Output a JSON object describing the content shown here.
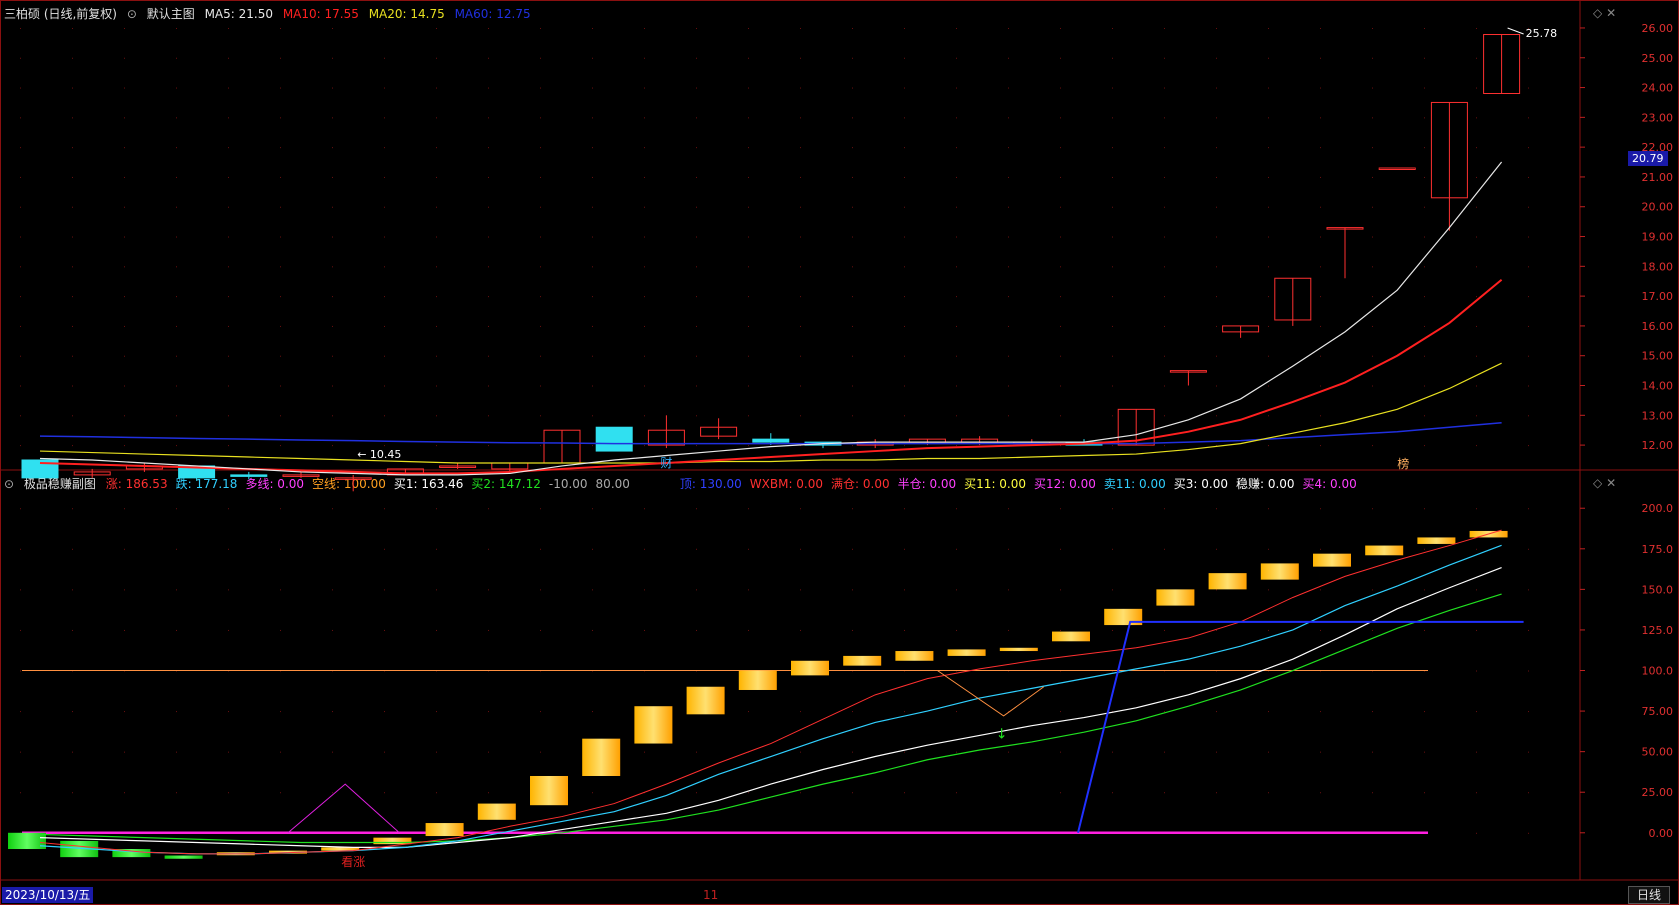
{
  "main_header": {
    "stock_name": "三柏硕 (日线,前复权)",
    "chart_label": "默认主图",
    "ma5": "MA5: 21.50",
    "ma10": "MA10: 17.55",
    "ma20": "MA20: 14.75",
    "ma60": "MA60: 12.75"
  },
  "sub_header": {
    "title": "极品稳赚副图",
    "items": [
      {
        "text": "涨: 186.53",
        "color": "#ff3030"
      },
      {
        "text": "跌: 177.18",
        "color": "#30d0ff"
      },
      {
        "text": "多线: 0.00",
        "color": "#ff40ff"
      },
      {
        "text": "空线: 100.00",
        "color": "#ffa020"
      },
      {
        "text": "买1: 163.46",
        "color": "#ffffff"
      },
      {
        "text": "买2: 147.12",
        "color": "#20e020"
      },
      {
        "text": "-10.00",
        "color": "#aaaaaa"
      },
      {
        "text": "80.00",
        "color": "#aaaaaa"
      },
      {
        "text": "顶: 130.00",
        "color": "#3040ff"
      },
      {
        "text": "WXBM: 0.00",
        "color": "#ff3030"
      },
      {
        "text": "满仓: 0.00",
        "color": "#ff3030"
      },
      {
        "text": "半仓: 0.00",
        "color": "#ff40ff"
      },
      {
        "text": "买11: 0.00",
        "color": "#ffff40"
      },
      {
        "text": "买12: 0.00",
        "color": "#ff40ff"
      },
      {
        "text": "卖11: 0.00",
        "color": "#30d0ff"
      },
      {
        "text": "买3: 0.00",
        "color": "#ffffff"
      },
      {
        "text": "稳赚: 0.00",
        "color": "#ffffff"
      },
      {
        "text": "买4: 0.00",
        "color": "#ff40ff"
      }
    ]
  },
  "price_axis": [
    "26.00",
    "25.00",
    "24.00",
    "23.00",
    "22.00",
    "21.00",
    "20.00",
    "19.00",
    "18.00",
    "17.00",
    "16.00",
    "15.00",
    "14.00",
    "13.00",
    "12.00"
  ],
  "current_price": "20.79",
  "high_label": "25.78",
  "low_label": "10.45",
  "sub_axis": [
    "200.0",
    "175.0",
    "150.0",
    "125.0",
    "100.0",
    "75.00",
    "50.00",
    "25.00",
    "0.00"
  ],
  "markers": {
    "cai": "财",
    "bang": "榜",
    "kanzhang": "看涨"
  },
  "date_label": "2023/10/13/五",
  "month_label": "11",
  "period_button": "日线",
  "colors": {
    "up": "#ff3030",
    "down": "#30e0f0",
    "ma5": "#e8e8e8",
    "ma10": "#ff2020",
    "ma20": "#e8e020",
    "ma60": "#2030e0"
  },
  "chart_data": {
    "type": "candlestick",
    "candles": [
      {
        "o": 11.5,
        "c": 10.9,
        "h": 11.5,
        "l": 10.9
      },
      {
        "o": 11.0,
        "c": 11.1,
        "h": 11.2,
        "l": 10.9
      },
      {
        "o": 11.2,
        "c": 11.3,
        "h": 11.4,
        "l": 11.1
      },
      {
        "o": 11.3,
        "c": 10.9,
        "h": 11.3,
        "l": 10.8
      },
      {
        "o": 11.0,
        "c": 10.95,
        "h": 11.1,
        "l": 10.85
      },
      {
        "o": 11.0,
        "c": 11.0,
        "h": 11.1,
        "l": 10.9
      },
      {
        "o": 10.9,
        "c": 10.9,
        "h": 11.0,
        "l": 10.45
      },
      {
        "o": 11.0,
        "c": 11.2,
        "h": 11.2,
        "l": 11.0
      },
      {
        "o": 11.3,
        "c": 11.3,
        "h": 11.4,
        "l": 11.2
      },
      {
        "o": 11.2,
        "c": 11.4,
        "h": 11.4,
        "l": 11.1
      },
      {
        "o": 11.4,
        "c": 12.5,
        "h": 12.5,
        "l": 11.4
      },
      {
        "o": 12.6,
        "c": 11.8,
        "h": 12.6,
        "l": 11.8
      },
      {
        "o": 12.0,
        "c": 12.5,
        "h": 13.0,
        "l": 11.9
      },
      {
        "o": 12.3,
        "c": 12.6,
        "h": 12.9,
        "l": 12.2
      },
      {
        "o": 12.2,
        "c": 12.1,
        "h": 12.4,
        "l": 12.0
      },
      {
        "o": 12.1,
        "c": 12.0,
        "h": 12.1,
        "l": 11.9
      },
      {
        "o": 12.0,
        "c": 12.1,
        "h": 12.2,
        "l": 11.9
      },
      {
        "o": 12.1,
        "c": 12.2,
        "h": 12.2,
        "l": 12.0
      },
      {
        "o": 12.1,
        "c": 12.2,
        "h": 12.3,
        "l": 12.0
      },
      {
        "o": 12.1,
        "c": 12.1,
        "h": 12.2,
        "l": 12.0
      },
      {
        "o": 12.1,
        "c": 12.0,
        "h": 12.2,
        "l": 12.0
      },
      {
        "o": 12.0,
        "c": 13.2,
        "h": 13.2,
        "l": 12.0
      },
      {
        "o": 14.5,
        "c": 14.5,
        "h": 14.5,
        "l": 14.0
      },
      {
        "o": 15.8,
        "c": 16.0,
        "h": 16.0,
        "l": 15.6
      },
      {
        "o": 16.2,
        "c": 17.6,
        "h": 17.6,
        "l": 16.0
      },
      {
        "o": 19.3,
        "c": 19.3,
        "h": 19.3,
        "l": 17.6
      },
      {
        "o": 21.3,
        "c": 21.3,
        "h": 21.3,
        "l": 21.3
      },
      {
        "o": 20.3,
        "c": 23.5,
        "h": 23.5,
        "l": 19.2
      },
      {
        "o": 23.8,
        "c": 25.78,
        "h": 25.78,
        "l": 23.8
      }
    ],
    "ma5": [
      11.55,
      11.5,
      11.4,
      11.3,
      11.2,
      11.1,
      11.05,
      11.0,
      11.0,
      11.05,
      11.3,
      11.5,
      11.65,
      11.8,
      11.95,
      12.05,
      12.1,
      12.1,
      12.1,
      12.1,
      12.1,
      12.35,
      12.85,
      13.55,
      14.65,
      15.8,
      17.2,
      19.3,
      21.5
    ],
    "ma10": [
      11.4,
      11.35,
      11.3,
      11.25,
      11.2,
      11.15,
      11.1,
      11.05,
      11.05,
      11.1,
      11.2,
      11.3,
      11.4,
      11.5,
      11.6,
      11.7,
      11.8,
      11.9,
      11.95,
      12.0,
      12.05,
      12.15,
      12.45,
      12.85,
      13.45,
      14.1,
      15.0,
      16.1,
      17.55
    ],
    "ma20": [
      11.8,
      11.75,
      11.7,
      11.65,
      11.6,
      11.55,
      11.5,
      11.45,
      11.4,
      11.4,
      11.4,
      11.4,
      11.4,
      11.45,
      11.45,
      11.5,
      11.5,
      11.55,
      11.55,
      11.6,
      11.65,
      11.7,
      11.85,
      12.05,
      12.4,
      12.75,
      13.2,
      13.9,
      14.75
    ],
    "ma60": [
      12.3,
      12.28,
      12.25,
      12.22,
      12.2,
      12.17,
      12.15,
      12.12,
      12.1,
      12.08,
      12.07,
      12.05,
      12.05,
      12.05,
      12.05,
      12.05,
      12.05,
      12.05,
      12.05,
      12.05,
      12.05,
      12.05,
      12.1,
      12.15,
      12.25,
      12.35,
      12.45,
      12.6,
      12.75
    ],
    "sub_bars": [
      {
        "v": [
          0,
          -10
        ],
        "c": "green"
      },
      {
        "v": [
          -15,
          -5
        ],
        "c": "green"
      },
      {
        "v": [
          -15,
          -10
        ],
        "c": "green"
      },
      {
        "v": [
          -16,
          -14
        ],
        "c": "green"
      },
      {
        "v": [
          -13,
          -12
        ],
        "c": "orange"
      },
      {
        "v": [
          -12,
          -11
        ],
        "c": "orange"
      },
      {
        "v": [
          -11,
          -9
        ],
        "c": "orange"
      },
      {
        "v": [
          -7,
          -3
        ],
        "c": "orange"
      },
      {
        "v": [
          -2,
          6
        ],
        "c": "orange"
      },
      {
        "v": [
          8,
          18
        ],
        "c": "orange"
      },
      {
        "v": [
          17,
          35
        ],
        "c": "orange"
      },
      {
        "v": [
          35,
          58
        ],
        "c": "orange"
      },
      {
        "v": [
          55,
          78
        ],
        "c": "orange"
      },
      {
        "v": [
          73,
          90
        ],
        "c": "orange"
      },
      {
        "v": [
          88,
          100
        ],
        "c": "orange"
      },
      {
        "v": [
          97,
          106
        ],
        "c": "orange"
      },
      {
        "v": [
          103,
          109
        ],
        "c": "orange"
      },
      {
        "v": [
          106,
          112
        ],
        "c": "orange"
      },
      {
        "v": [
          109,
          113
        ],
        "c": "orange"
      },
      {
        "v": [
          112,
          114
        ],
        "c": "orange"
      },
      {
        "v": [
          118,
          124
        ],
        "c": "orange"
      },
      {
        "v": [
          128,
          138
        ],
        "c": "orange"
      },
      {
        "v": [
          140,
          150
        ],
        "c": "orange"
      },
      {
        "v": [
          150,
          160
        ],
        "c": "orange"
      },
      {
        "v": [
          156,
          166
        ],
        "c": "orange"
      },
      {
        "v": [
          164,
          172
        ],
        "c": "orange"
      },
      {
        "v": [
          171,
          177
        ],
        "c": "orange"
      },
      {
        "v": [
          178,
          182
        ],
        "c": "orange"
      },
      {
        "v": [
          182,
          186
        ]
      }
    ],
    "line_zhang": [
      -6,
      -9,
      -12,
      -13,
      -13,
      -12,
      -11,
      -7,
      -3,
      4,
      10,
      18,
      30,
      43,
      55,
      70,
      85,
      95,
      101,
      106,
      110,
      114,
      120,
      130,
      145,
      158,
      168,
      177,
      186.53
    ],
    "line_die": [
      -8,
      -10,
      -12,
      -13,
      -13,
      -12,
      -11,
      -9,
      -5,
      1,
      7,
      13,
      23,
      36,
      47,
      58,
      68,
      75,
      83,
      89,
      95,
      101,
      107,
      115,
      125,
      140,
      152,
      165,
      177.18
    ],
    "line_mai1": [
      -3,
      -4,
      -5,
      -6,
      -7,
      -8,
      -9,
      -9,
      -6,
      -3,
      2,
      7,
      12,
      20,
      30,
      39,
      47,
      54,
      60,
      66,
      71,
      77,
      85,
      95,
      107,
      122,
      138,
      151,
      163.46
    ],
    "line_mai2": [
      -1,
      -2,
      -3,
      -4,
      -5,
      -6,
      -6,
      -6,
      -5,
      -3,
      0,
      4,
      8,
      14,
      22,
      30,
      37,
      45,
      51,
      56,
      62,
      69,
      78,
      88,
      100,
      113,
      126,
      137,
      147.12
    ]
  }
}
